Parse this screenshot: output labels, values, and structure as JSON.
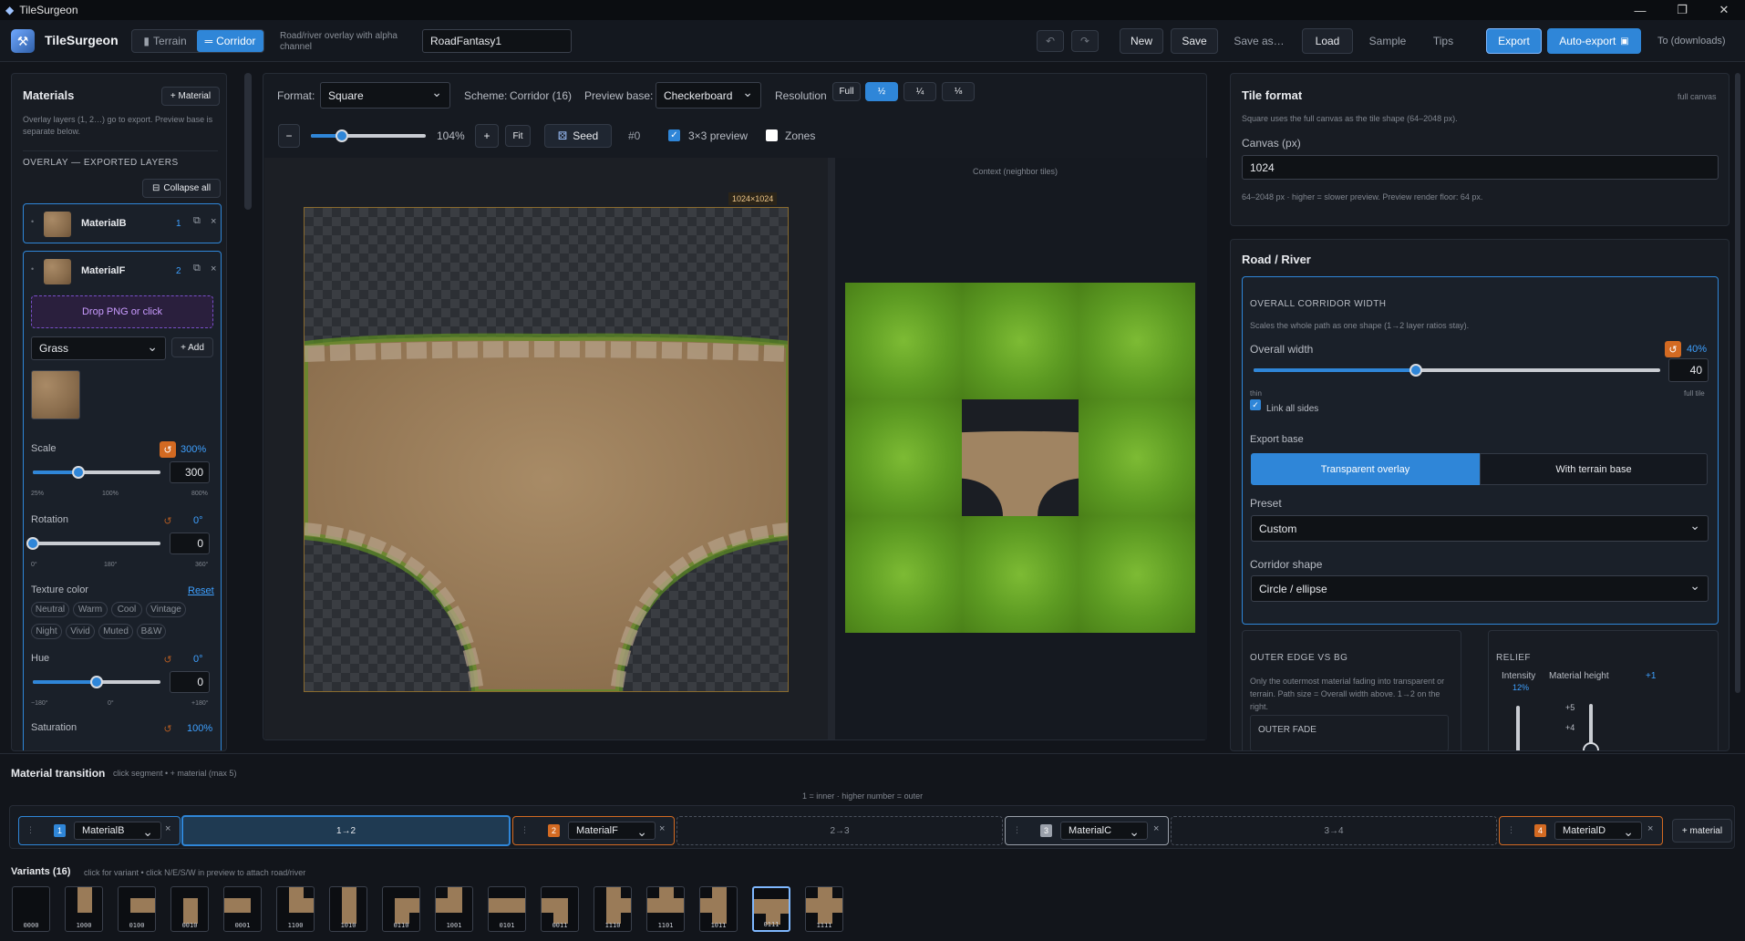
{
  "window": {
    "title": "TileSurgeon"
  },
  "topbar": {
    "app_name": "TileSurgeon",
    "mode_terrain": "Terrain",
    "mode_corridor": "Corridor",
    "mode_desc": "Road/river overlay with alpha channel",
    "project_name": "RoadFantasy1",
    "new": "New",
    "save": "Save",
    "save_as": "Save as…",
    "load": "Load",
    "sample": "Sample",
    "tips": "Tips",
    "export": "Export",
    "auto_export": "Auto-export",
    "destination": "To (downloads)"
  },
  "left": {
    "title": "Materials",
    "add_material": "+ Material",
    "desc": "Overlay layers (1, 2…) go to export. Preview base is separate below.",
    "section": "OVERLAY — EXPORTED LAYERS",
    "collapse_all": "Collapse all",
    "layers": [
      {
        "name": "MaterialB",
        "index": "1"
      },
      {
        "name": "MaterialF",
        "index": "2"
      }
    ],
    "drop_hint": "Drop PNG or click",
    "texture_select": "Grass",
    "add": "+ Add",
    "scale_label": "Scale",
    "scale_value": "300%",
    "scale_input": "300",
    "scale_ticks": [
      "25%",
      "100%",
      "800%"
    ],
    "scale_fraction": 0.36,
    "rotation_label": "Rotation",
    "rotation_value": "0°",
    "rotation_input": "0",
    "rotation_ticks": [
      "0°",
      "180°",
      "360°"
    ],
    "rotation_fraction": 0.0,
    "texture_color": "Texture color",
    "reset": "Reset",
    "color_chips": [
      "Neutral",
      "Warm",
      "Cool",
      "Vintage",
      "Night",
      "Vivid",
      "Muted",
      "B&W"
    ],
    "hue_label": "Hue",
    "hue_value": "0°",
    "hue_input": "0",
    "hue_ticks": [
      "−180°",
      "0°",
      "+180°"
    ],
    "hue_fraction": 0.5,
    "saturation_label": "Saturation",
    "saturation_value": "100%"
  },
  "center": {
    "format_label": "Format:",
    "format_value": "Square",
    "scheme_label": "Scheme:",
    "scheme_value": "Corridor (16)",
    "preview_base_label": "Preview base:",
    "preview_base_value": "Checkerboard",
    "resolution_label": "Resolution",
    "resolution_options": [
      "Full",
      "½",
      "¼",
      "⅛"
    ],
    "zoom_minus": "−",
    "zoom_value": "104%",
    "zoom_plus": "+",
    "fit": "Fit",
    "zoom_fraction": 0.27,
    "seed": "Seed",
    "seed_value": "#0",
    "preview3x3": "3×3 preview",
    "zones": "Zones",
    "canvas_size": "1024×1024",
    "context_label": "Context (neighbor tiles)"
  },
  "right": {
    "tile_format_title": "Tile format",
    "tile_format_badge": "full canvas",
    "tile_format_desc": "Square uses the full canvas as the tile shape (64–2048 px).",
    "canvas_label": "Canvas (px)",
    "canvas_value": "1024",
    "canvas_hint": "64–2048 px · higher = slower preview. Preview render floor: 64 px.",
    "road_title": "Road / River",
    "overall_title": "OVERALL CORRIDOR WIDTH",
    "overall_desc": "Scales the whole path as one shape (1→2 layer ratios stay).",
    "overall_width_label": "Overall width",
    "overall_width_value": "40%",
    "overall_width_input": "40",
    "overall_width_fraction": 0.4,
    "thin": "thin",
    "full_tile": "full tile",
    "link_sides": "Link all sides",
    "export_base": "Export base",
    "transparent_overlay": "Transparent overlay",
    "with_terrain": "With terrain base",
    "preset_label": "Preset",
    "preset_value": "Custom",
    "shape_label": "Corridor shape",
    "shape_value": "Circle / ellipse",
    "outer_title": "OUTER EDGE VS BG",
    "outer_desc": "Only the outermost material fading into transparent or terrain. Path size = Overall width above. 1→2 on the right.",
    "outer_fade": "OUTER FADE",
    "relief_title": "RELIEF",
    "intensity_label": "Intensity",
    "intensity_value": "12%",
    "material_height": "Material height",
    "material_height_value": "+1",
    "relief_ticks": [
      "+5",
      "+4"
    ]
  },
  "transition": {
    "title": "Material transition",
    "hint": "click segment • + material (max 5)",
    "legend": "1 = inner · higher number = outer",
    "stops": [
      {
        "index": "1",
        "name": "MaterialB",
        "color": "#2f86d8"
      },
      {
        "index": "2",
        "name": "MaterialF",
        "color": "#d36a22"
      },
      {
        "index": "3",
        "name": "MaterialC",
        "color": "#9aa0aa"
      },
      {
        "index": "4",
        "name": "MaterialD",
        "color": "#d36a22"
      }
    ],
    "segments": [
      "1→2",
      "2→3",
      "3→4"
    ],
    "add_material": "+ material"
  },
  "variants": {
    "title": "Variants (16)",
    "hint": "click for variant • click N/E/S/W in preview to attach road/river",
    "codes": [
      "0000",
      "1000",
      "0100",
      "0010",
      "0001",
      "1100",
      "1010",
      "0110",
      "1001",
      "0101",
      "0011",
      "1110",
      "1101",
      "1011",
      "0111",
      "1111"
    ],
    "selected": "0111"
  },
  "colors": {
    "accent": "#2f86d8",
    "orange": "#d36a22",
    "bg": "#12151b",
    "purple": "#7a4fc9"
  }
}
